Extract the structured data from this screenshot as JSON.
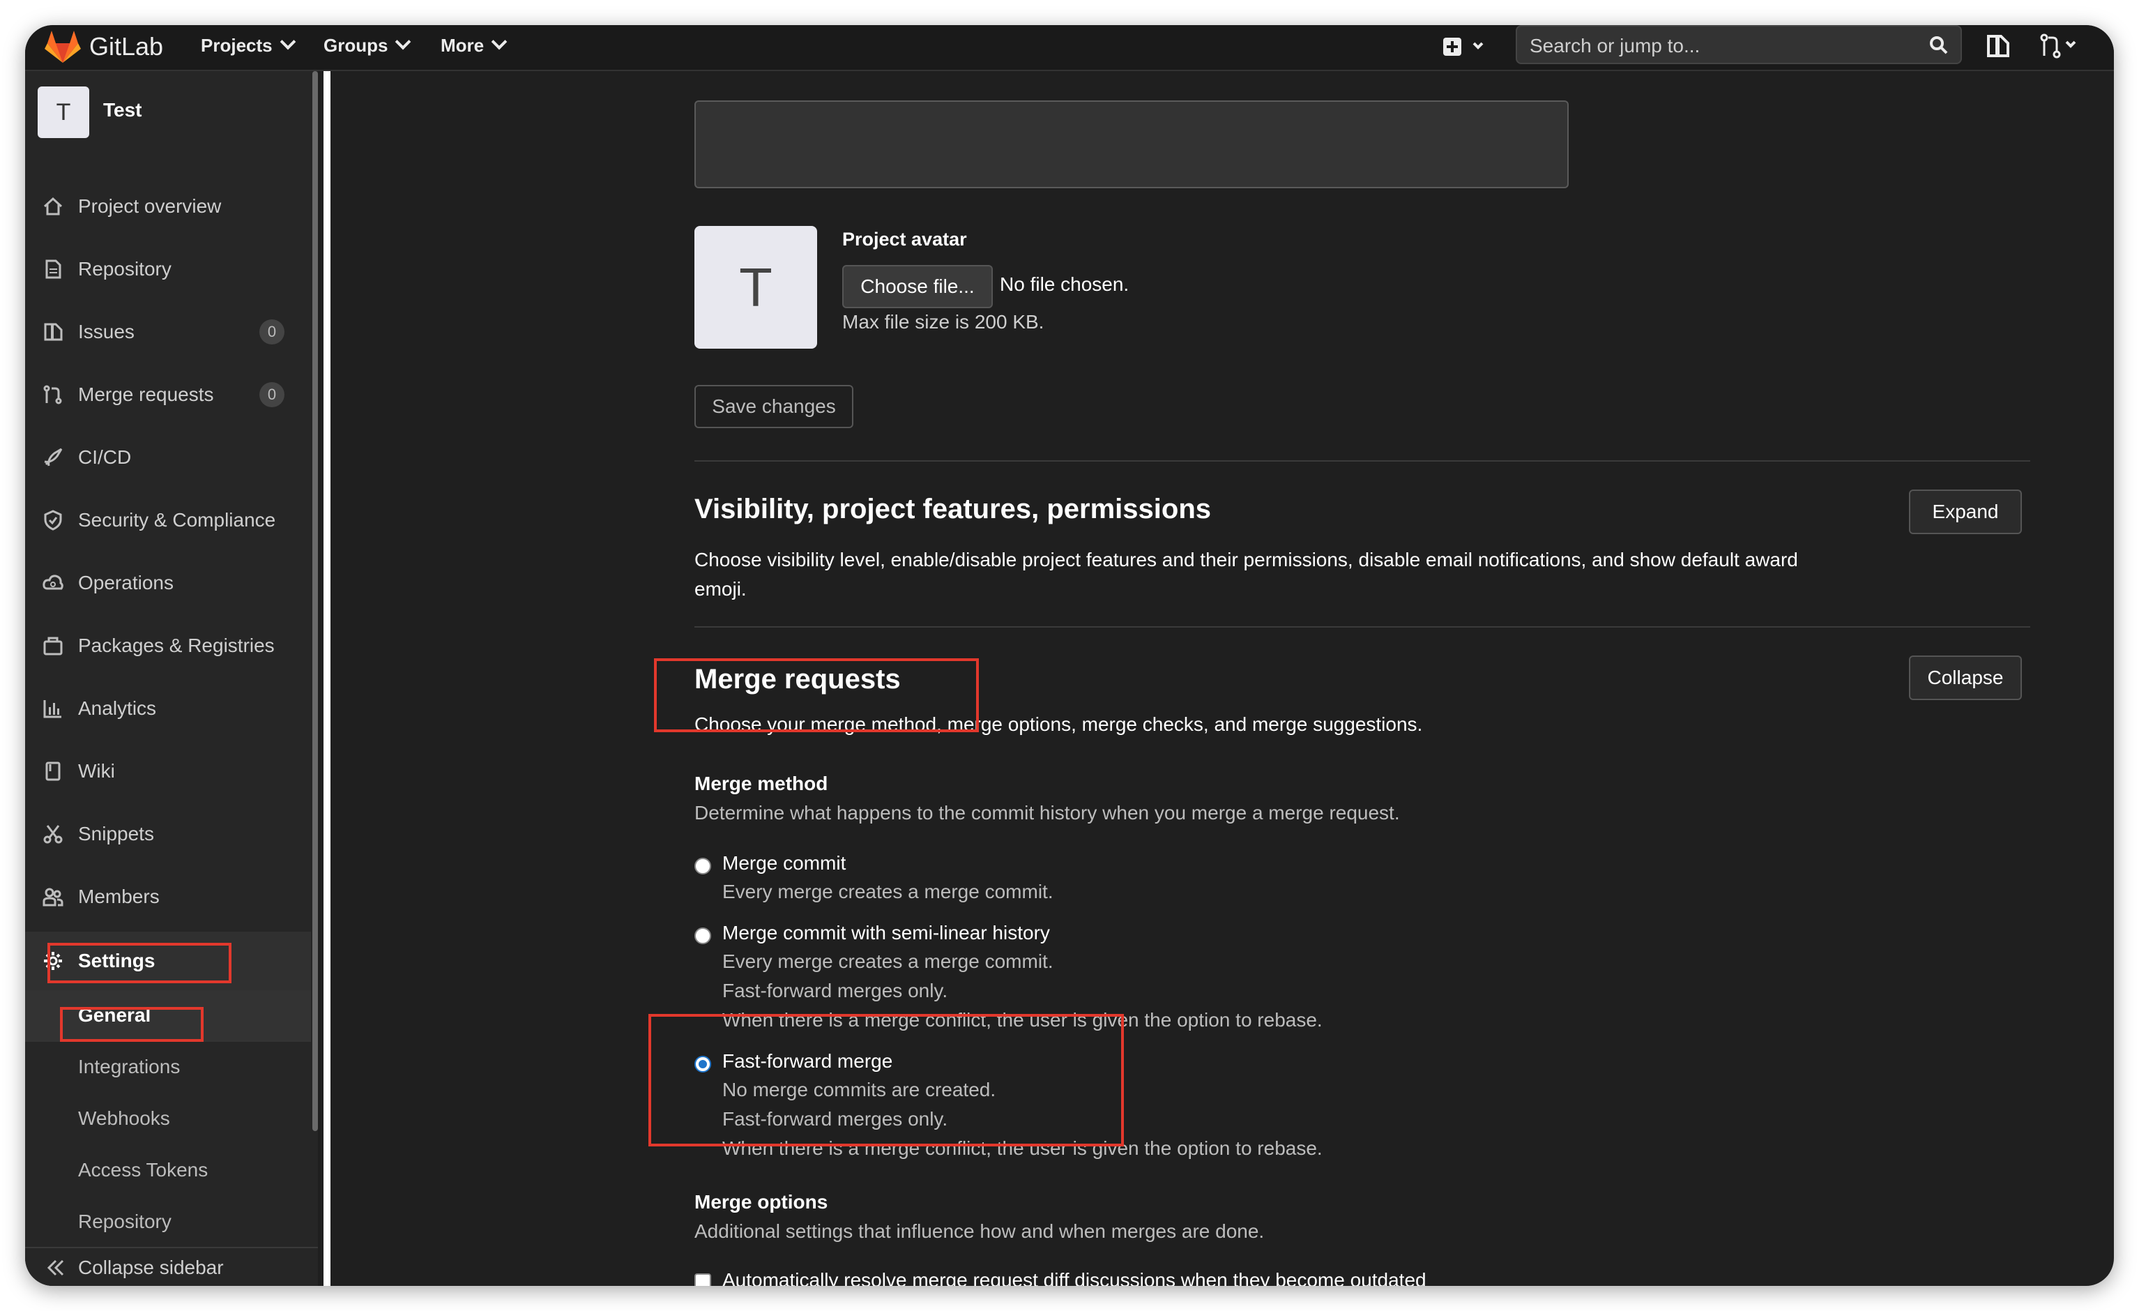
{
  "topbar": {
    "brand": "GitLab",
    "nav": [
      {
        "label": "Projects"
      },
      {
        "label": "Groups"
      },
      {
        "label": "More"
      }
    ],
    "search_placeholder": "Search or jump to..."
  },
  "sidebar": {
    "project_initial": "T",
    "project_name": "Test",
    "items": [
      {
        "label": "Project overview",
        "icon": "home-icon"
      },
      {
        "label": "Repository",
        "icon": "document-icon"
      },
      {
        "label": "Issues",
        "icon": "issues-icon",
        "count": "0"
      },
      {
        "label": "Merge requests",
        "icon": "merge-request-icon",
        "count": "0"
      },
      {
        "label": "CI/CD",
        "icon": "rocket-icon"
      },
      {
        "label": "Security & Compliance",
        "icon": "shield-icon"
      },
      {
        "label": "Operations",
        "icon": "cloud-gear-icon"
      },
      {
        "label": "Packages & Registries",
        "icon": "package-icon"
      },
      {
        "label": "Analytics",
        "icon": "chart-icon"
      },
      {
        "label": "Wiki",
        "icon": "book-icon"
      },
      {
        "label": "Snippets",
        "icon": "scissors-icon"
      },
      {
        "label": "Members",
        "icon": "users-icon"
      },
      {
        "label": "Settings",
        "icon": "gear-icon"
      }
    ],
    "settings_sub": [
      {
        "label": "General"
      },
      {
        "label": "Integrations"
      },
      {
        "label": "Webhooks"
      },
      {
        "label": "Access Tokens"
      },
      {
        "label": "Repository"
      }
    ],
    "collapse_label": "Collapse sidebar"
  },
  "main": {
    "avatar": {
      "initial": "T",
      "label": "Project avatar",
      "choose_file": "Choose file...",
      "no_file": "No file chosen.",
      "max_size": "Max file size is 200 KB."
    },
    "save_label": "Save changes",
    "visibility": {
      "title": "Visibility, project features, permissions",
      "description": "Choose visibility level, enable/disable project features and their permissions, disable email notifications, and show default award emoji.",
      "button": "Expand"
    },
    "merge_requests": {
      "title": "Merge requests",
      "description": "Choose your merge method, merge options, merge checks, and merge suggestions.",
      "button": "Collapse",
      "method_heading": "Merge method",
      "method_help": "Determine what happens to the commit history when you merge a merge request.",
      "options": [
        {
          "label": "Merge commit",
          "help": [
            "Every merge creates a merge commit."
          ],
          "selected": false
        },
        {
          "label": "Merge commit with semi-linear history",
          "help": [
            "Every merge creates a merge commit.",
            "Fast-forward merges only.",
            "When there is a merge conflict, the user is given the option to rebase."
          ],
          "selected": false
        },
        {
          "label": "Fast-forward merge",
          "help": [
            "No merge commits are created.",
            "Fast-forward merges only.",
            "When there is a merge conflict, the user is given the option to rebase."
          ],
          "selected": true
        }
      ],
      "options_heading": "Merge options",
      "options_help": "Additional settings that influence how and when merges are done.",
      "checkbox_label": "Automatically resolve merge request diff discussions when they become outdated"
    }
  },
  "colors": {
    "highlight": "#e2382c",
    "radio_selected": "#1f75cb",
    "background": "#1f1f1f"
  }
}
